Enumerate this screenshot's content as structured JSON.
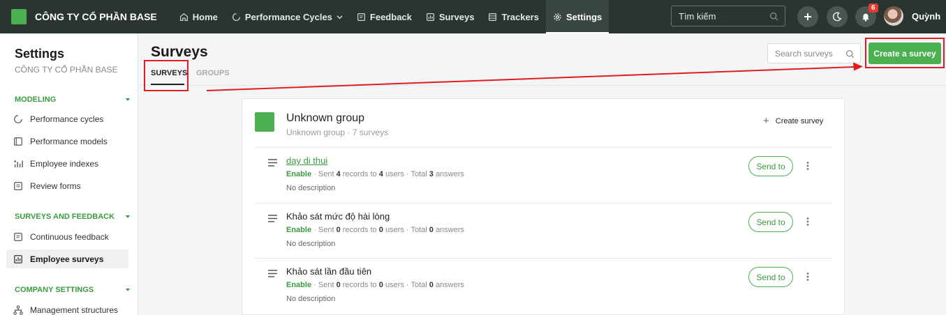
{
  "company": "CÔNG TY CỔ PHẦN BASE",
  "nav": {
    "home": "Home",
    "performance_cycles": "Performance Cycles",
    "feedback": "Feedback",
    "surveys": "Surveys",
    "trackers": "Trackers",
    "settings": "Settings"
  },
  "top_search": {
    "placeholder": "Tìm kiếm"
  },
  "notifications": {
    "count": "6"
  },
  "user": {
    "name": "Quỳnh"
  },
  "sidebar": {
    "title": "Settings",
    "subtitle": "CÔNG TY CỔ PHẦN BASE",
    "sections": [
      {
        "label": "MODELING",
        "items": [
          "Performance cycles",
          "Performance models",
          "Employee indexes",
          "Review forms"
        ]
      },
      {
        "label": "SURVEYS AND FEEDBACK",
        "items": [
          "Continuous feedback",
          "Employee surveys"
        ]
      },
      {
        "label": "COMPANY SETTINGS",
        "items": [
          "Management structures"
        ]
      }
    ]
  },
  "main": {
    "title": "Surveys",
    "tabs": [
      "SURVEYS",
      "GROUPS"
    ],
    "search_placeholder": "Search surveys",
    "create_label": "Create a survey"
  },
  "group": {
    "name": "Unknown group",
    "meta": "Unknown group · 7 surveys",
    "create_label": "Create survey",
    "surveys": [
      {
        "name": "day di thui",
        "status": "Enable",
        "sent_records": "4",
        "users": "4",
        "answers": "3",
        "description": "No description",
        "action": "Send to"
      },
      {
        "name": "Khảo sát mức độ hài lòng",
        "status": "Enable",
        "sent_records": "0",
        "users": "0",
        "answers": "0",
        "description": "No description",
        "action": "Send to"
      },
      {
        "name": "Khảo sát lần đầu tiên",
        "status": "Enable",
        "sent_records": "0",
        "users": "0",
        "answers": "0",
        "description": "No description",
        "action": "Send to"
      }
    ]
  },
  "text": {
    "sent": "Sent",
    "records_to": "records to",
    "users": "users",
    "total": "Total",
    "answers": "answers",
    "sep": "·"
  },
  "colors": {
    "accent": "#4caf50",
    "topbar": "#2b3530",
    "annotation": "#e21c1c"
  }
}
